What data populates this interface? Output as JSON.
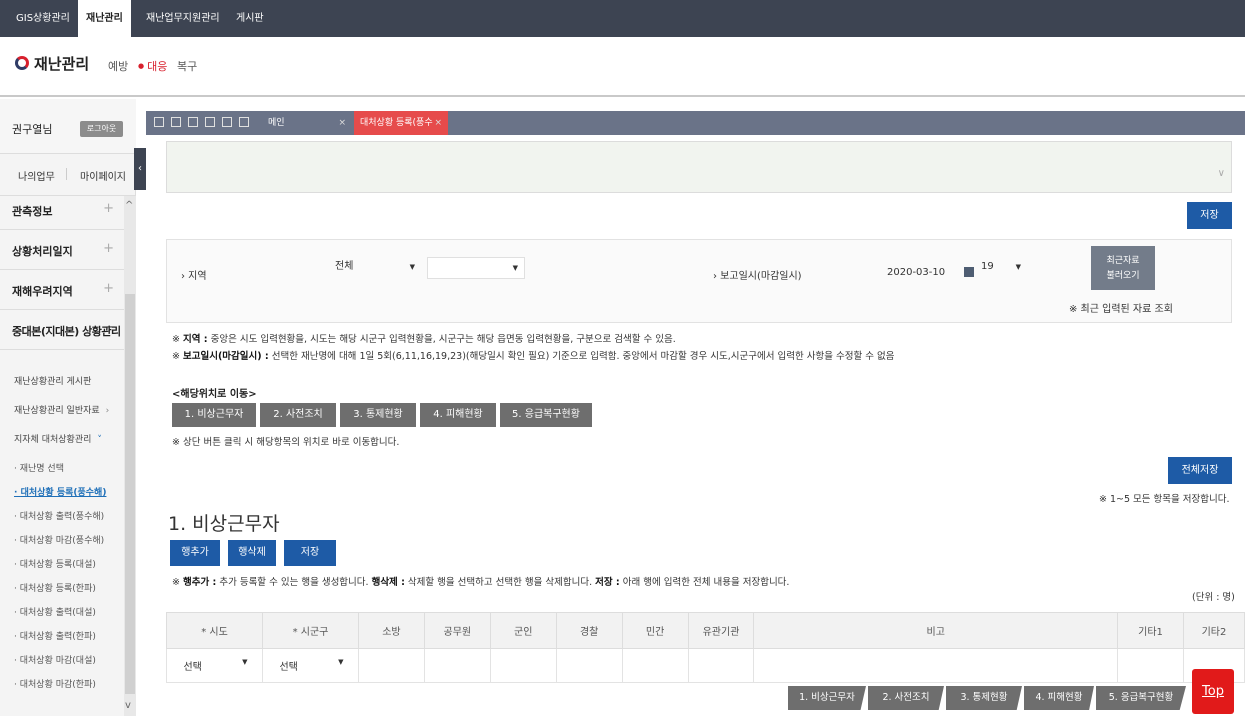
{
  "topnav": {
    "items": [
      {
        "label": "GIS상황관리"
      },
      {
        "label": "재난관리"
      },
      {
        "label": "재난업무지원관리"
      },
      {
        "label": "게시판"
      }
    ]
  },
  "header": {
    "title": "재난관리",
    "subnav": [
      "예방",
      "대응",
      "복구"
    ]
  },
  "sidebar": {
    "user_name": "권구열님",
    "logout_label": "로그아웃",
    "my_work": "나의업무",
    "my_page": "마이페이지",
    "sections": [
      "관측정보",
      "상황처리일지",
      "재해우려지역",
      "중대본(지대본) 상황관리"
    ],
    "subsections": [
      "재난상황관리 게시판",
      "재난상황관리 일반자료",
      "지자체 대처상황관리"
    ],
    "leaves": [
      "재난명 선택",
      "대처상황 등록(풍수해)",
      "대처상황 출력(풍수해)",
      "대처상황 마감(풍수해)",
      "대처상황 등록(대설)",
      "대처상황 등록(한파)",
      "대처상황 출력(대설)",
      "대처상황 출력(한파)",
      "대처상황 마감(대설)",
      "대처상황 마감(한파)"
    ]
  },
  "tabs": {
    "main": "메인",
    "active": "대처상황 등록(풍수",
    "close_glyph": "×"
  },
  "content": {
    "save_label": "저장",
    "region_label": "› 지역",
    "region_value": "전체",
    "region_sub_value": "",
    "report_label": "› 보고일시(마감일시)",
    "report_date": "2020-03-10",
    "report_hour": "19",
    "recent_btn_line1": "최근자료",
    "recent_btn_line2": "불러오기",
    "recent_note": "※ 최근 입력된 자료 조회",
    "note1_prefix": "※ ",
    "note1_bold": "지역 :",
    "note1_text": " 중앙은 시도 입력현황을, 시도는 해당 시군구 입력현황을, 시군구는 해당 읍면동 입력현황을, 구분으로 검색할 수 있음.",
    "note2_prefix": "※ ",
    "note2_bold": "보고일시(마감일시) :",
    "note2_text": " 선택한 재난명에 대해 1일 5회(6,11,16,19,23)(해당일시 확인 필요) 기준으로 입력함. 중앙에서 마감할 경우 시도,시군구에서 입력한 사항을 수정할 수 없음",
    "jump_title": "<해당위치로 이동>",
    "jump_buttons": [
      "1. 비상근무자",
      "2. 사전조치",
      "3. 통제현황",
      "4. 피해현황",
      "5. 응급복구현황"
    ],
    "jump_note": "※ 상단 버튼 클릭 시 해당항목의 위치로 바로 이동합니다.",
    "save_all_label": "전체저장",
    "save_all_note": "※ 1~5 모든 항목을 저장합니다.",
    "section_title": "1. 비상근무자",
    "add_row_label": "행추가",
    "del_row_label": "행삭제",
    "row_save_label": "저장",
    "help_prefix": "※ ",
    "help_b1": "행추가 :",
    "help_t1": " 추가 등록할 수 있는 행을 생성합니다. ",
    "help_b2": "행삭제 :",
    "help_t2": " 삭제할 행을 선택하고 선택한 행을 삭제합니다. ",
    "help_b3": "저장 :",
    "help_t3": " 아래 행에 입력한 전체 내용을 저장합니다.",
    "unit": "(단위 : 명)",
    "columns": [
      "* 시도",
      "* 시군구",
      "소방",
      "공무원",
      "군인",
      "경찰",
      "민간",
      "유관기관",
      "비고",
      "기타1",
      "기타2"
    ],
    "row_sido": "선택",
    "row_sigungu": "선택",
    "float_buttons": [
      "1. 비상근무자",
      "2. 사전조치",
      "3. 통제현황",
      "4. 피해현황",
      "5. 응급복구현황"
    ],
    "top_label": "Top"
  },
  "colors": {
    "nav_bg": "#3d4452",
    "brand_red": "#d8202d",
    "primary_blue": "#1e5ba6",
    "tab_red": "#e64b4b",
    "grey_btn": "#6e6e6e"
  }
}
